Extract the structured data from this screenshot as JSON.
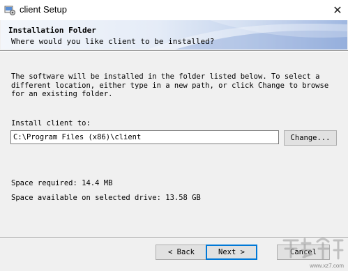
{
  "window": {
    "title": "client Setup",
    "icon": "setup-installer-icon",
    "close_glyph": "✕"
  },
  "header": {
    "title": "Installation Folder",
    "subtitle": "Where would you like client to be installed?"
  },
  "body": {
    "description": "The software will be installed in the folder listed below. To select a different location, either type in a new path, or click Change to browse for an existing folder.",
    "install_label": "Install client to:",
    "install_path": "C:\\Program Files (x86)\\client",
    "change_label": "Change...",
    "space_required": "Space required: 14.4 MB",
    "space_available": "Space available on selected drive: 13.58 GB"
  },
  "buttons": {
    "back_label": "< Back",
    "next_label": "Next >",
    "cancel_label": "Cancel"
  },
  "watermark": {
    "site": "www.xz7.com"
  },
  "colors": {
    "focus_border": "#0078d7",
    "button_face": "#e1e1e1",
    "banner_accent": "#7e9fd6"
  }
}
